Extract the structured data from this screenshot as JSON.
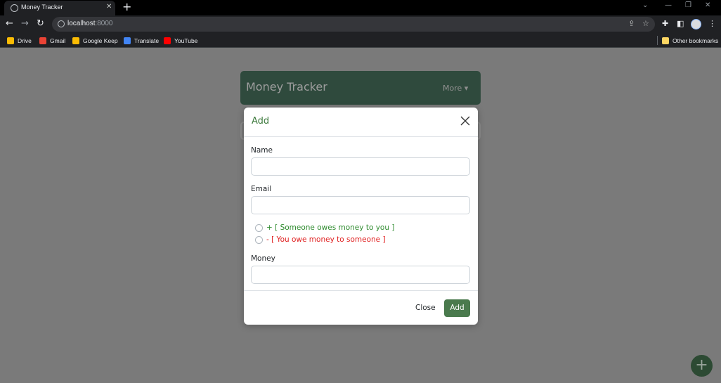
{
  "browser": {
    "tab_title": "Money Tracker",
    "new_tab": "+",
    "url_host": "localhost",
    "url_port": ":8000",
    "bookmarks": [
      {
        "label": "Drive",
        "color": "#fbbc04"
      },
      {
        "label": "Gmail",
        "color": "#ea4335"
      },
      {
        "label": "Google Keep",
        "color": "#fbbc04"
      },
      {
        "label": "Translate",
        "color": "#4285f4"
      },
      {
        "label": "YouTube",
        "color": "#ff0000"
      }
    ],
    "other_bookmarks": "Other bookmarks"
  },
  "app": {
    "title": "Money Tracker",
    "more_label": "More",
    "fab_label": "+"
  },
  "modal": {
    "title": "Add",
    "name_label": "Name",
    "name_value": "",
    "email_label": "Email",
    "email_value": "",
    "radio_owed": "+ [ Someone owes money to you ]",
    "radio_owe": "- [ You owe money to someone ]",
    "money_label": "Money",
    "money_value": "",
    "close_button": "Close",
    "add_button": "Add"
  },
  "colors": {
    "accent_green": "#4a7a4d",
    "title_green": "#3d7a3d",
    "owed_green": "#2e8b2e",
    "owe_red": "#e02020"
  }
}
